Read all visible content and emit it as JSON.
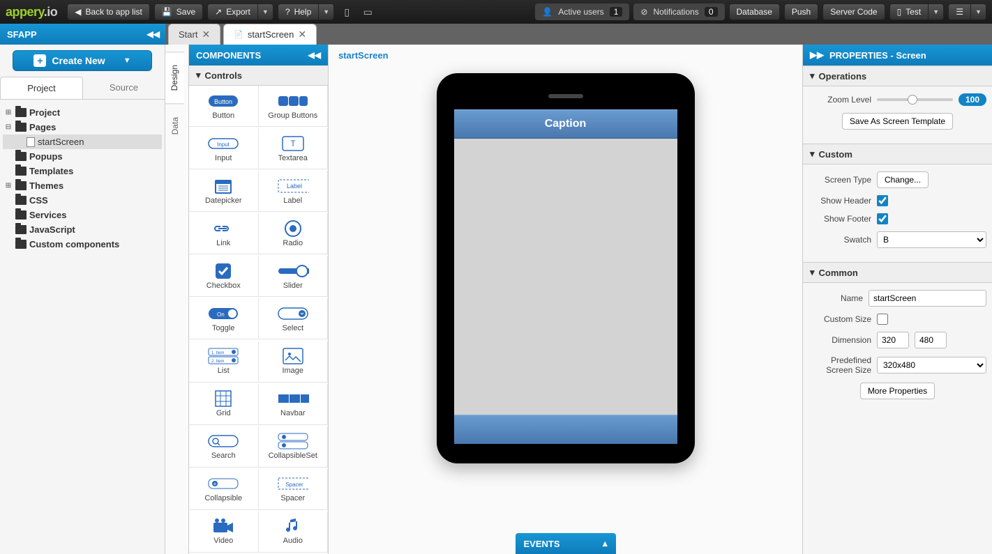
{
  "topbar": {
    "logo1": "appery",
    "logo2": ".io",
    "back": "Back to app list",
    "save": "Save",
    "export": "Export",
    "help": "Help",
    "active_users": "Active users",
    "active_users_count": "1",
    "notifications": "Notifications",
    "notifications_count": "0",
    "database": "Database",
    "push": "Push",
    "server_code": "Server Code",
    "test": "Test"
  },
  "appname": "SFAPP",
  "tabs": {
    "start": "Start",
    "screen": "startScreen"
  },
  "leftpanel": {
    "create": "Create New",
    "sub_project": "Project",
    "sub_source": "Source",
    "tree": {
      "project": "Project",
      "pages": "Pages",
      "startscreen": "startScreen",
      "popups": "Popups",
      "templates": "Templates",
      "themes": "Themes",
      "css": "CSS",
      "services": "Services",
      "javascript": "JavaScript",
      "custom": "Custom components"
    }
  },
  "verttabs": {
    "design": "Design",
    "data": "Data"
  },
  "palette": {
    "title": "COMPONENTS",
    "section": "Controls",
    "items": [
      "Button",
      "Group Buttons",
      "Input",
      "Textarea",
      "Datepicker",
      "Label",
      "Link",
      "Radio",
      "Checkbox",
      "Slider",
      "Toggle",
      "Select",
      "List",
      "Image",
      "Grid",
      "Navbar",
      "Search",
      "CollapsibleSet",
      "Collapsible",
      "Spacer",
      "Video",
      "Audio"
    ]
  },
  "canvas": {
    "breadcrumb": "startScreen",
    "caption": "Caption",
    "events": "EVENTS"
  },
  "props": {
    "title": "PROPERTIES - Screen",
    "sec_ops": "Operations",
    "zoom_label": "Zoom Level",
    "zoom_value": "100",
    "save_tmpl": "Save As Screen Template",
    "sec_custom": "Custom",
    "screen_type": "Screen Type",
    "change": "Change...",
    "show_header": "Show Header",
    "show_footer": "Show Footer",
    "swatch": "Swatch",
    "swatch_val": "B",
    "sec_common": "Common",
    "name": "Name",
    "name_val": "startScreen",
    "custom_size": "Custom Size",
    "dimension": "Dimension",
    "dim_w": "320",
    "dim_h": "480",
    "predef": "Predefined Screen Size",
    "predef_val": "320x480",
    "more": "More Properties"
  }
}
